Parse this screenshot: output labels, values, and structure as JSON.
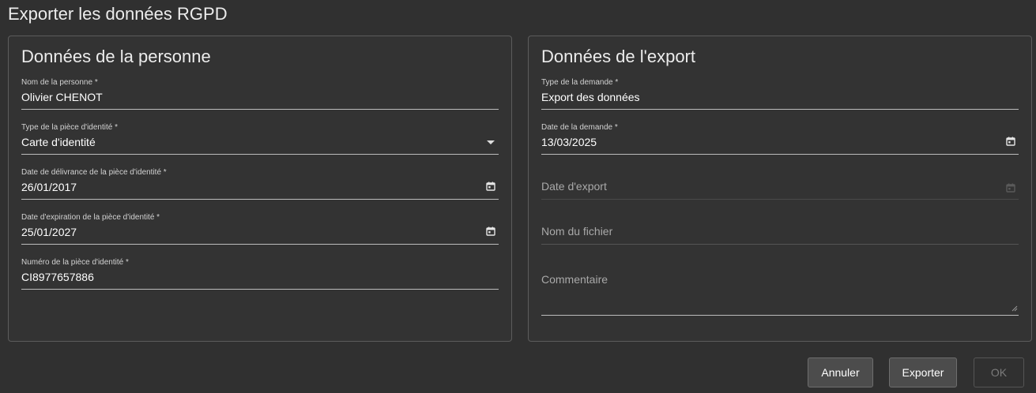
{
  "dialog": {
    "title": "Exporter les données RGPD"
  },
  "person_panel": {
    "title": "Données de la personne",
    "fields": [
      {
        "label": "Nom de la personne *",
        "value": "Olivier CHENOT",
        "kind": "text"
      },
      {
        "label": "Type de la pièce d'identité *",
        "value": "Carte d'identité",
        "kind": "select",
        "icon": "chevron-down-icon"
      },
      {
        "label": "Date de délivrance de la pièce d'identité *",
        "value": "26/01/2017",
        "kind": "date",
        "icon": "calendar-icon"
      },
      {
        "label": "Date d'expiration de la pièce d'identité *",
        "value": "25/01/2027",
        "kind": "date",
        "icon": "calendar-icon"
      },
      {
        "label": "Numéro de la pièce d'identité *",
        "value": "CI8977657886",
        "kind": "text"
      }
    ]
  },
  "export_panel": {
    "title": "Données de l'export",
    "fields": [
      {
        "label": "Type de la demande *",
        "value": "Export des données",
        "kind": "text"
      },
      {
        "label": "Date de la demande *",
        "value": "13/03/2025",
        "kind": "date",
        "icon": "calendar-icon"
      },
      {
        "label": "Date d'export",
        "value": "",
        "kind": "date",
        "state": "disabled",
        "icon": "calendar-icon"
      },
      {
        "label": "Nom du fichier",
        "value": "",
        "kind": "text",
        "state": "empty"
      },
      {
        "label": "Commentaire",
        "value": "",
        "kind": "textarea",
        "state": "empty"
      }
    ]
  },
  "buttons": {
    "cancel": "Annuler",
    "export": "Exporter",
    "ok": "OK"
  },
  "colors": {
    "background": "#303030",
    "panel_border": "#5c5c5c",
    "text": "#ffffff",
    "muted_text": "#a9a9a9",
    "button_bg": "#4c4c4c",
    "disabled_text": "#7b7b7b"
  }
}
